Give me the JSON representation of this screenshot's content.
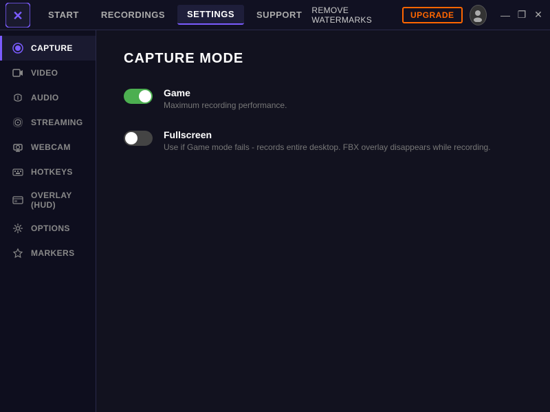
{
  "titlebar": {
    "logo_alt": "FBX Logo",
    "nav": [
      {
        "id": "start",
        "label": "START",
        "active": false
      },
      {
        "id": "recordings",
        "label": "RECORDINGS",
        "active": false
      },
      {
        "id": "settings",
        "label": "SETTINGS",
        "active": true
      },
      {
        "id": "support",
        "label": "SUPPORT",
        "active": false
      }
    ],
    "remove_watermarks": "REMOVE WATERMARKS",
    "upgrade_label": "UPGRADE",
    "controls": {
      "minimize": "—",
      "maximize": "❐",
      "close": "✕"
    }
  },
  "sidebar": {
    "items": [
      {
        "id": "capture",
        "label": "CAPTURE",
        "icon": "●",
        "active": true
      },
      {
        "id": "video",
        "label": "VIDEO",
        "icon": "🎬",
        "active": false
      },
      {
        "id": "audio",
        "label": "AUDIO",
        "icon": "🎧",
        "active": false
      },
      {
        "id": "streaming",
        "label": "STREAMING",
        "icon": "📡",
        "active": false
      },
      {
        "id": "webcam",
        "label": "WEBCAM",
        "icon": "📷",
        "active": false
      },
      {
        "id": "hotkeys",
        "label": "HOTKEYS",
        "icon": "⌨",
        "active": false
      },
      {
        "id": "overlay",
        "label": "OVERLAY (HUD)",
        "icon": "🖥",
        "active": false
      },
      {
        "id": "options",
        "label": "OPTIONS",
        "icon": "⚙",
        "active": false
      },
      {
        "id": "markers",
        "label": "MARKERS",
        "icon": "🛡",
        "active": false
      }
    ]
  },
  "content": {
    "title": "CAPTURE MODE",
    "modes": [
      {
        "id": "game",
        "label": "Game",
        "description": "Maximum recording performance.",
        "enabled": true
      },
      {
        "id": "fullscreen",
        "label": "Fullscreen",
        "description": "Use if Game mode fails - records entire desktop. FBX overlay disappears while recording.",
        "enabled": false
      }
    ]
  }
}
